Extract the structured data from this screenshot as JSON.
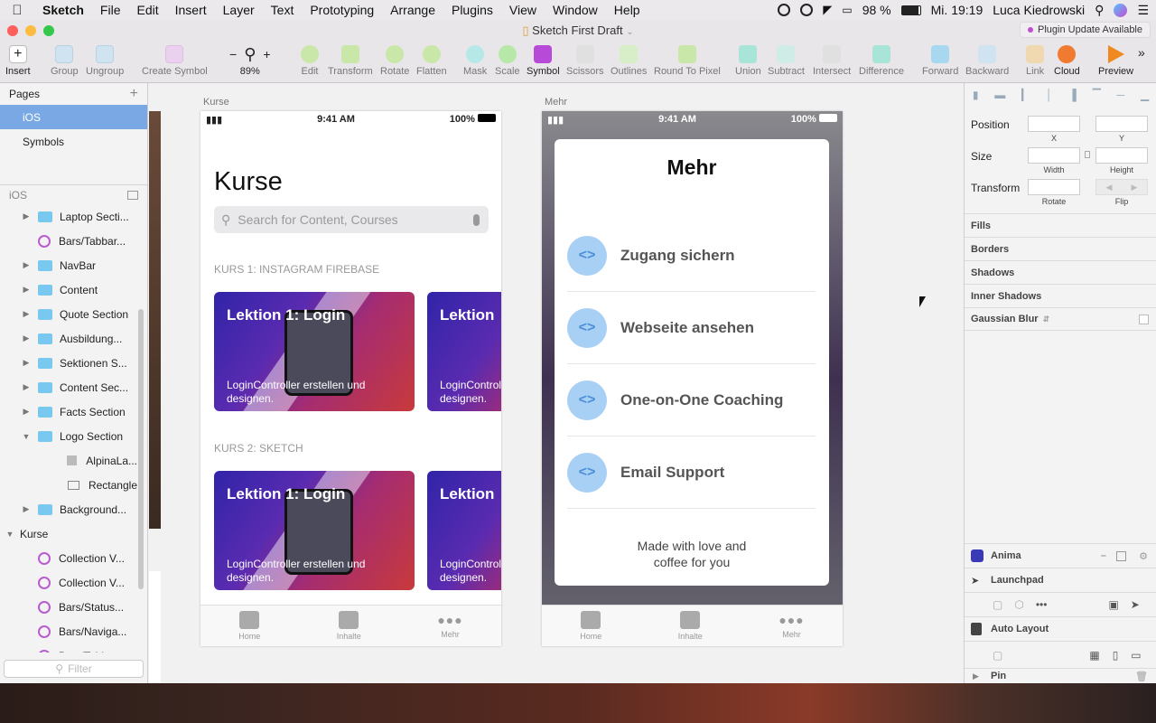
{
  "menubar": {
    "app": "Sketch",
    "items": [
      "File",
      "Edit",
      "Insert",
      "Layer",
      "Text",
      "Prototyping",
      "Arrange",
      "Plugins",
      "View",
      "Window",
      "Help"
    ],
    "battery": "98 %",
    "clock": "Mi. 19:19",
    "user": "Luca Kiedrowski"
  },
  "window": {
    "title": "Sketch First Draft",
    "plugin_badge": "Plugin Update Available"
  },
  "toolbar": {
    "insert": "Insert",
    "group": "Group",
    "ungroup": "Ungroup",
    "create_symbol": "Create Symbol",
    "zoom_minus": "−",
    "zoom_plus": "+",
    "zoom_value": "89%",
    "edit": "Edit",
    "transform": "Transform",
    "rotate": "Rotate",
    "flatten": "Flatten",
    "mask": "Mask",
    "scale": "Scale",
    "symbol": "Symbol",
    "scissors": "Scissors",
    "outlines": "Outlines",
    "round_to_pixel": "Round To Pixel",
    "union": "Union",
    "subtract": "Subtract",
    "intersect": "Intersect",
    "difference": "Difference",
    "forward": "Forward",
    "backward": "Backward",
    "link": "Link",
    "cloud": "Cloud",
    "preview": "Preview"
  },
  "sidebar": {
    "pages_header": "Pages",
    "pages": [
      "iOS",
      "Symbols"
    ],
    "layers_header": "iOS",
    "layers": [
      {
        "name": "Laptop Secti...",
        "type": "folder",
        "indent": 1
      },
      {
        "name": "Bars/Tabbar...",
        "type": "symbol",
        "indent": 1
      },
      {
        "name": "NavBar",
        "type": "folder",
        "indent": 1
      },
      {
        "name": "Content",
        "type": "folder",
        "indent": 1
      },
      {
        "name": "Quote Section",
        "type": "folder",
        "indent": 1
      },
      {
        "name": "Ausbildung...",
        "type": "folder",
        "indent": 1
      },
      {
        "name": "Sektionen S...",
        "type": "folder",
        "indent": 1
      },
      {
        "name": "Content Sec...",
        "type": "folder",
        "indent": 1
      },
      {
        "name": "Facts Section",
        "type": "folder",
        "indent": 1
      },
      {
        "name": "Logo Section",
        "type": "folder",
        "indent": 1
      },
      {
        "name": "AlpinaLa...",
        "type": "image",
        "indent": 2
      },
      {
        "name": "Rectangle",
        "type": "rect",
        "indent": 2
      },
      {
        "name": "Background...",
        "type": "folder",
        "indent": 1
      },
      {
        "name": "Kurse",
        "type": "artboard",
        "indent": 0
      },
      {
        "name": "Collection V...",
        "type": "symbol",
        "indent": 1
      },
      {
        "name": "Collection V...",
        "type": "symbol",
        "indent": 1
      },
      {
        "name": "Bars/Status...",
        "type": "symbol",
        "indent": 1
      },
      {
        "name": "Bars/Naviga...",
        "type": "symbol",
        "indent": 1
      },
      {
        "name": "Bars/Tabbar...",
        "type": "symbol",
        "indent": 1
      }
    ],
    "filter_placeholder": "Filter"
  },
  "artboard_kurse": {
    "label": "Kurse",
    "time": "9:41 AM",
    "battery": "100%",
    "heading": "Kurse",
    "search_placeholder": "Search for Content, Courses",
    "section1": "KURS 1: INSTAGRAM FIREBASE",
    "section2": "KURS 2: SKETCH",
    "card_title": "Lektion 1: Login",
    "card_title_short": "Lektion",
    "card_sub": "LoginController erstellen und designen.",
    "card_sub_short": "LoginControl designen.",
    "tabs": [
      "Home",
      "Inhalte",
      "Mehr"
    ]
  },
  "artboard_mehr": {
    "label": "Mehr",
    "time": "9:41 AM",
    "battery": "100%",
    "heading": "Mehr",
    "items": [
      "Zugang sichern",
      "Webseite ansehen",
      "One-on-One Coaching",
      "Email Support"
    ],
    "footer": "Made with love and coffee for you",
    "tabs": [
      "Home",
      "Inhalte",
      "Mehr"
    ]
  },
  "inspector": {
    "position": "Position",
    "x": "X",
    "y": "Y",
    "size": "Size",
    "width": "Width",
    "height": "Height",
    "transform": "Transform",
    "rotate": "Rotate",
    "flip": "Flip",
    "sections": [
      "Fills",
      "Borders",
      "Shadows",
      "Inner Shadows",
      "Gaussian Blur"
    ],
    "plugins": [
      "Anima",
      "Launchpad",
      "Auto Layout",
      "Pin"
    ]
  }
}
